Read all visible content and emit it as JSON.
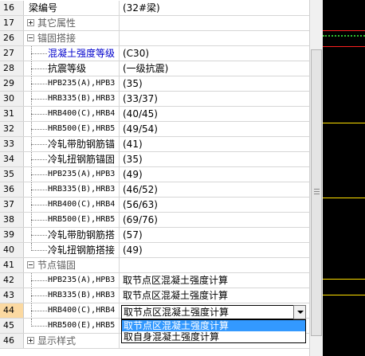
{
  "rows": [
    {
      "num": "16",
      "name": "梁编号",
      "value": "(32#梁)",
      "level": 0,
      "type": "plain"
    },
    {
      "num": "17",
      "name": "其它属性",
      "value": "",
      "level": 0,
      "type": "group",
      "expanded": false
    },
    {
      "num": "26",
      "name": "锚固搭接",
      "value": "",
      "level": 0,
      "type": "group",
      "expanded": true
    },
    {
      "num": "27",
      "name": "混凝土强度等级",
      "value": "(C30)",
      "level": 1,
      "type": "child",
      "color": "blue"
    },
    {
      "num": "28",
      "name": "抗震等级",
      "value": "(一级抗震)",
      "level": 1,
      "type": "child"
    },
    {
      "num": "29",
      "name": "HPB235(A),HPB3",
      "value": "(35)",
      "level": 1,
      "type": "child",
      "mono": true
    },
    {
      "num": "30",
      "name": "HRB335(B),HRB3",
      "value": "(33/37)",
      "level": 1,
      "type": "child",
      "mono": true
    },
    {
      "num": "31",
      "name": "HRB400(C),HRB4",
      "value": "(40/45)",
      "level": 1,
      "type": "child",
      "mono": true
    },
    {
      "num": "32",
      "name": "HRB500(E),HRB5",
      "value": "(49/54)",
      "level": 1,
      "type": "child",
      "mono": true
    },
    {
      "num": "33",
      "name": "冷轧带肋钢筋锚",
      "value": "(41)",
      "level": 1,
      "type": "child"
    },
    {
      "num": "34",
      "name": "冷轧扭钢筋锚固",
      "value": "(35)",
      "level": 1,
      "type": "child"
    },
    {
      "num": "35",
      "name": "HPB235(A),HPB3",
      "value": "(49)",
      "level": 1,
      "type": "child",
      "mono": true
    },
    {
      "num": "36",
      "name": "HRB335(B),HRB3",
      "value": "(46/52)",
      "level": 1,
      "type": "child",
      "mono": true
    },
    {
      "num": "37",
      "name": "HRB400(C),HRB4",
      "value": "(56/63)",
      "level": 1,
      "type": "child",
      "mono": true
    },
    {
      "num": "38",
      "name": "HRB500(E),HRB5",
      "value": "(69/76)",
      "level": 1,
      "type": "child",
      "mono": true
    },
    {
      "num": "39",
      "name": "冷轧带肋钢筋搭",
      "value": "(57)",
      "level": 1,
      "type": "child"
    },
    {
      "num": "40",
      "name": "冷轧扭钢筋搭接",
      "value": "(49)",
      "level": 1,
      "type": "child"
    },
    {
      "num": "41",
      "name": "节点锚固",
      "value": "",
      "level": 0,
      "type": "group",
      "expanded": true,
      "color": "gray"
    },
    {
      "num": "42",
      "name": "HPB235(A),HPB3",
      "value": "取节点区混凝土强度计算",
      "level": 1,
      "type": "child",
      "mono": true
    },
    {
      "num": "43",
      "name": "HRB335(B),HRB3",
      "value": "取节点区混凝土强度计算",
      "level": 1,
      "type": "child",
      "mono": true
    },
    {
      "num": "44",
      "name": "HRB400(C),HRB4",
      "value": "",
      "level": 1,
      "type": "child",
      "mono": true,
      "active": true
    },
    {
      "num": "45",
      "name": "HRB500(E),HRB5",
      "value": "",
      "level": 1,
      "type": "child",
      "mono": true
    },
    {
      "num": "46",
      "name": "显示样式",
      "value": "",
      "level": 0,
      "type": "group",
      "expanded": false
    }
  ],
  "dropdown": {
    "current": "取节点区混凝土强度计算",
    "options": [
      "取节点区混凝土强度计算",
      "取自身混凝土强度计算"
    ],
    "selected_index": 0
  },
  "colors": {
    "accent": "#3399ff",
    "active_row": "#fbd9a1",
    "blue_text": "#0000cc",
    "canvas": "#000000"
  }
}
